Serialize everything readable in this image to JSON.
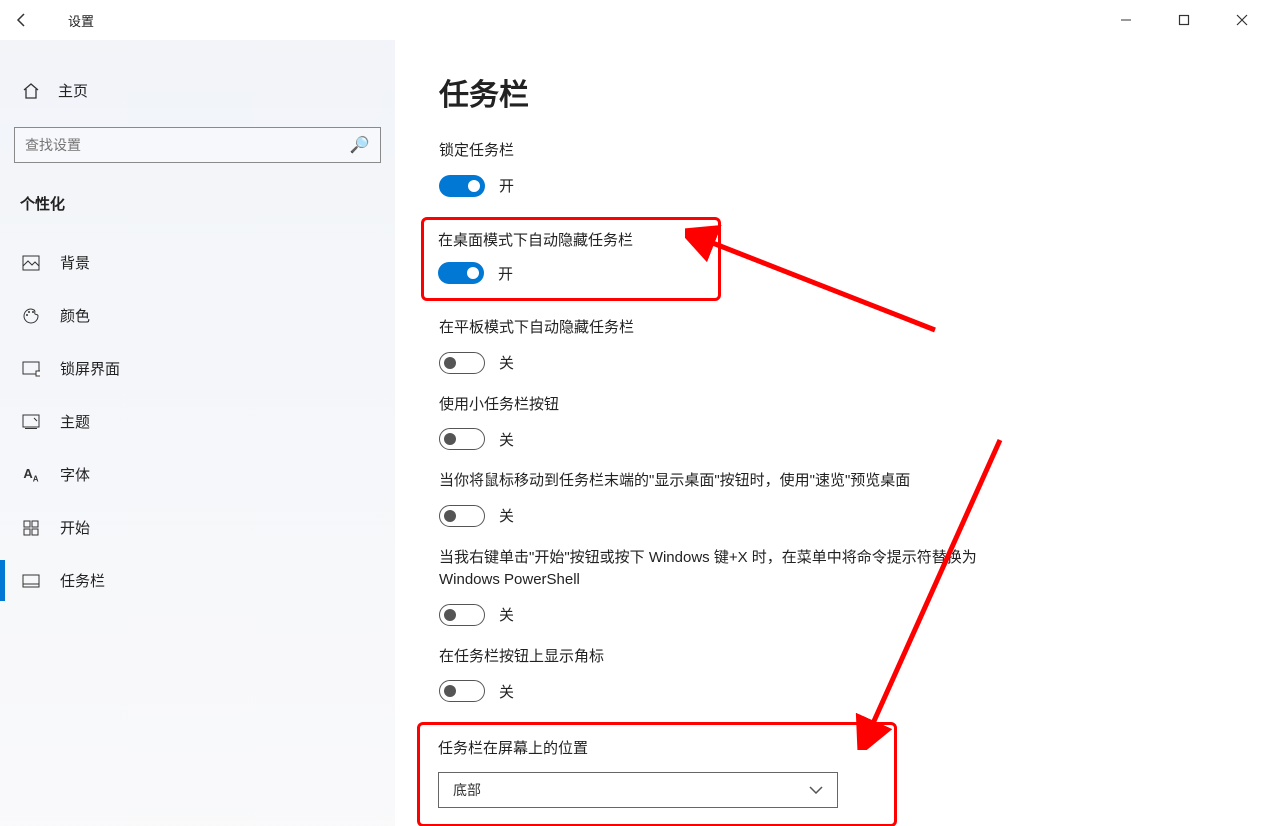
{
  "window": {
    "title": "设置"
  },
  "sidebar": {
    "home": "主页",
    "search_placeholder": "查找设置",
    "category": "个性化",
    "items": [
      {
        "icon": "image-icon",
        "label": "背景"
      },
      {
        "icon": "palette-icon",
        "label": "颜色"
      },
      {
        "icon": "lockscreen-icon",
        "label": "锁屏界面"
      },
      {
        "icon": "theme-icon",
        "label": "主题"
      },
      {
        "icon": "font-icon",
        "label": "字体"
      },
      {
        "icon": "start-icon",
        "label": "开始"
      },
      {
        "icon": "taskbar-icon",
        "label": "任务栏"
      }
    ],
    "selected_index": 6
  },
  "page": {
    "heading": "任务栏",
    "settings": [
      {
        "label": "锁定任务栏",
        "state": "on",
        "state_text": "开"
      },
      {
        "label": "在桌面模式下自动隐藏任务栏",
        "state": "on",
        "state_text": "开",
        "highlight": true
      },
      {
        "label": "在平板模式下自动隐藏任务栏",
        "state": "off",
        "state_text": "关"
      },
      {
        "label": "使用小任务栏按钮",
        "state": "off",
        "state_text": "关"
      },
      {
        "label": "当你将鼠标移动到任务栏末端的\"显示桌面\"按钮时，使用\"速览\"预览桌面",
        "state": "off",
        "state_text": "关"
      },
      {
        "label": "当我右键单击\"开始\"按钮或按下 Windows 键+X 时，在菜单中将命令提示符替换为 Windows PowerShell",
        "state": "off",
        "state_text": "关"
      },
      {
        "label": "在任务栏按钮上显示角标",
        "state": "off",
        "state_text": "关"
      }
    ],
    "position_section": {
      "heading": "任务栏在屏幕上的位置",
      "value": "底部"
    }
  }
}
